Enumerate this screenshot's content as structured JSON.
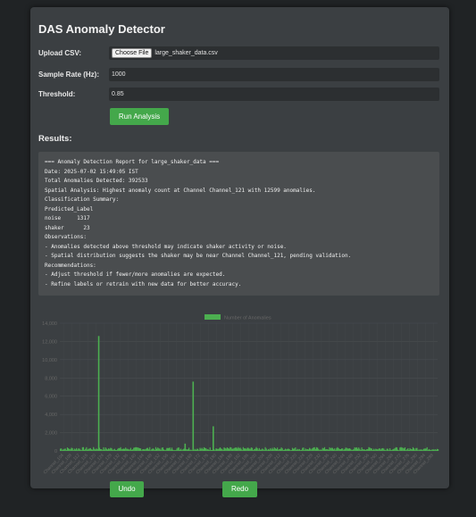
{
  "app": {
    "title": "DAS Anomaly Detector"
  },
  "form": {
    "upload_label": "Upload CSV:",
    "file_button": "Choose File",
    "file_name": "large_shaker_data.csv",
    "sample_rate_label": "Sample Rate (Hz):",
    "sample_rate_value": "1000",
    "threshold_label": "Threshold:",
    "threshold_value": "0.85",
    "run_button": "Run Analysis"
  },
  "results": {
    "heading": "Results:",
    "report_lines": [
      "=== Anomaly Detection Report for large_shaker_data ===",
      "Date: 2025-07-02 15:49:05 IST",
      "Total Anomalies Detected: 392533",
      "Spatial Analysis: Highest anomaly count at Channel Channel_121 with 12599 anomalies.",
      "Classification Summary:",
      "Predicted_Label",
      "noise     1317",
      "shaker      23",
      "Observations:",
      "- Anomalies detected above threshold may indicate shaker activity or noise.",
      "- Spatial distribution suggests the shaker may be near Channel Channel_121, pending validation.",
      "Recommendations:",
      "- Adjust threshold if fewer/more anomalies are expected.",
      "- Refine labels or retrain with new data for better accuracy."
    ]
  },
  "chart_data": {
    "type": "bar",
    "legend": "Number of Anomalies",
    "legend_position": "top",
    "color": "#4caf50",
    "grid": true,
    "ylim": [
      0,
      14000
    ],
    "yticks": [
      "0",
      "2,000",
      "4,000",
      "6,000",
      "8,000",
      "10,000",
      "12,000",
      "14,000"
    ],
    "xticks": [
      "Channel_104",
      "Channel_108",
      "Channel_112",
      "Channel_116",
      "Channel_120",
      "Channel_124",
      "Channel_128",
      "Channel_132",
      "Channel_136",
      "Channel_140",
      "Channel_144",
      "Channel_148",
      "Channel_152",
      "Channel_156",
      "Channel_160",
      "Channel_164",
      "Channel_168",
      "Channel_172",
      "Channel_176",
      "Channel_180",
      "Channel_184",
      "Channel_188",
      "Channel_192",
      "Channel_196",
      "Channel_200",
      "Channel_204",
      "Channel_208",
      "Channel_212",
      "Channel_216",
      "Channel_220",
      "Channel_224",
      "Channel_228",
      "Channel_232",
      "Channel_236",
      "Channel_240",
      "Channel_244",
      "Channel_248",
      "Channel_252",
      "Channel_256",
      "Channel_260",
      "Channel_264",
      "Channel_268",
      "Channel_272",
      "Channel_276",
      "Channel_280",
      "Channel_284",
      "Channel_288"
    ],
    "peaks": [
      {
        "category": "Channel_121",
        "value": 12599
      },
      {
        "category": "Channel_168",
        "value": 7600
      },
      {
        "category": "Channel_178",
        "value": 2700
      },
      {
        "category": "Channel_164",
        "value": 800
      }
    ],
    "baseline_value": 250
  },
  "actions": {
    "undo": "Undo",
    "redo": "Redo"
  }
}
